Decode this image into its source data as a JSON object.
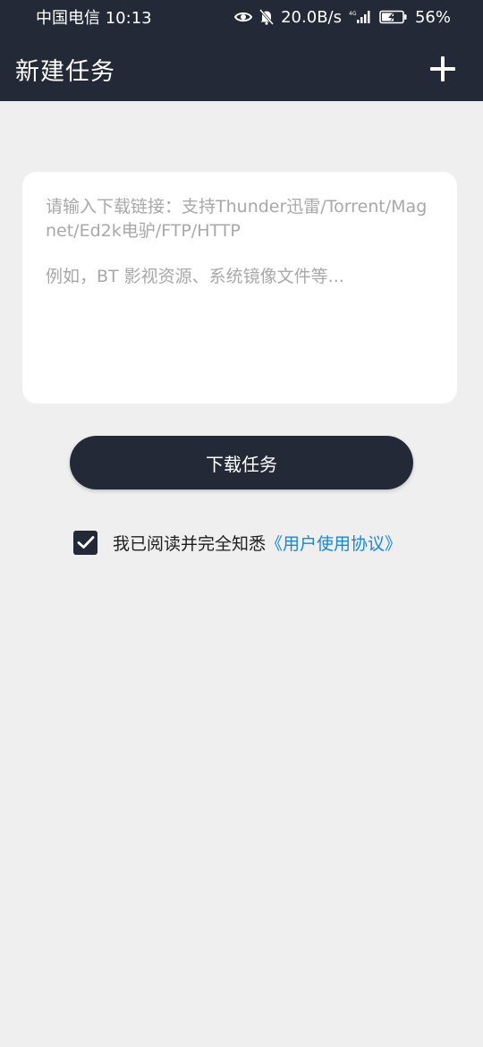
{
  "status_bar": {
    "carrier_time": "中国电信 10:13",
    "speed": "20.0B/s",
    "network": "4G",
    "battery": "56%",
    "icons": [
      "eye-icon",
      "bell-off-icon",
      "signal-icon",
      "battery-icon"
    ]
  },
  "app_bar": {
    "title": "新建任务",
    "add_icon": "plus-icon"
  },
  "input": {
    "placeholder_line1": "请输入下载链接：支持Thunder迅雷/Torrent/Magnet/Ed2k电驴/FTP/HTTP",
    "placeholder_line2": "例如，BT 影视资源、系统镜像文件等..."
  },
  "download_button": "下载任务",
  "agreement": {
    "checked": true,
    "text": "我已阅读并完全知悉",
    "link": "《用户使用协议》"
  },
  "colors": {
    "header_bg": "#232936",
    "page_bg": "#efefef",
    "link": "#1a87d2"
  }
}
